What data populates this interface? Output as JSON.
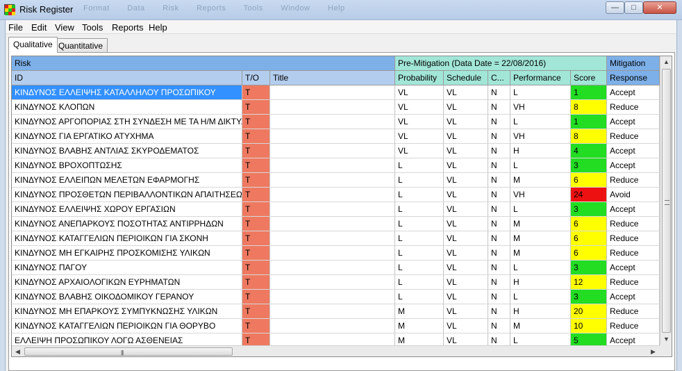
{
  "window": {
    "title": "Risk Register",
    "ghost_menu": [
      "Format",
      "Data",
      "Risk",
      "Reports",
      "Tools",
      "Window",
      "Help"
    ],
    "min_glyph": "—",
    "max_glyph": "□",
    "close_glyph": "✕"
  },
  "menubar": [
    "File",
    "Edit",
    "View",
    "Tools",
    "Reports",
    "Help"
  ],
  "tabs": [
    {
      "label": "Qualitative",
      "active": true
    },
    {
      "label": "Quantitative",
      "active": false
    }
  ],
  "grid": {
    "groups": {
      "risk": "Risk",
      "pre": "Pre-Mitigation (Data Date = 22/08/2016)",
      "mitigation": "Mitigation"
    },
    "columns": [
      "ID",
      "T/O",
      "Title",
      "Probability",
      "Schedule",
      "C...",
      "Performance",
      "Score",
      "Response"
    ],
    "rows": [
      {
        "id": "ΚΙΝΔΥΝΟΣ ΕΛΛΕΙΨΗΣ ΚΑΤΑΛΛΗΛΟΥ ΠΡΟΣΩΠΙΚΟΥ",
        "to": "T",
        "title": "",
        "prob": "VL",
        "sched": "VL",
        "cost": "N",
        "perf": "L",
        "score": "1",
        "level": "green",
        "response": "Accept",
        "selected": true
      },
      {
        "id": "ΚΙΝΔΥΝΟΣ ΚΛΟΠΩΝ",
        "to": "T",
        "title": "",
        "prob": "VL",
        "sched": "VL",
        "cost": "N",
        "perf": "VH",
        "score": "8",
        "level": "yellow",
        "response": "Reduce"
      },
      {
        "id": "ΚΙΝΔΥΝΟΣ ΑΡΓΟΠΟΡΙΑΣ ΣΤΗ ΣΥΝΔΕΣΗ ΜΕ ΤΑ Η/Μ ΔΙΚΤΥΑ",
        "to": "T",
        "title": "",
        "prob": "VL",
        "sched": "VL",
        "cost": "N",
        "perf": "L",
        "score": "1",
        "level": "green",
        "response": "Accept"
      },
      {
        "id": "ΚΙΝΔΥΝΟΣ ΓΙΑ ΕΡΓΑΤΙΚΟ ΑΤΥΧΗΜΑ",
        "to": "T",
        "title": "",
        "prob": "VL",
        "sched": "VL",
        "cost": "N",
        "perf": "VH",
        "score": "8",
        "level": "yellow",
        "response": "Reduce"
      },
      {
        "id": "ΚΙΝΔΥΝΟΣ ΒΛΑΒΗΣ ΑΝΤΛΙΑΣ ΣΚΥΡΟΔΕΜΑΤΟΣ",
        "to": "T",
        "title": "",
        "prob": "VL",
        "sched": "VL",
        "cost": "N",
        "perf": "H",
        "score": "4",
        "level": "green",
        "response": "Accept"
      },
      {
        "id": "ΚΙΝΔΥΝΟΣ ΒΡΟΧΟΠΤΩΣΗΣ",
        "to": "T",
        "title": "",
        "prob": "L",
        "sched": "VL",
        "cost": "N",
        "perf": "L",
        "score": "3",
        "level": "green",
        "response": "Accept"
      },
      {
        "id": "ΚΙΝΔΥΝΟΣ ΕΛΛΕΙΠΩΝ ΜΕΛΕΤΩΝ ΕΦΑΡΜΟΓΗΣ",
        "to": "T",
        "title": "",
        "prob": "L",
        "sched": "VL",
        "cost": "N",
        "perf": "M",
        "score": "6",
        "level": "yellow",
        "response": "Reduce"
      },
      {
        "id": "ΚΙΝΔΥΝΟΣ ΠΡΟΣΘΕΤΩΝ ΠΕΡΙΒΑΛΛΟΝΤΙΚΩΝ ΑΠΑΙΤΗΣΕΩΝ",
        "to": "T",
        "title": "",
        "prob": "L",
        "sched": "VL",
        "cost": "N",
        "perf": "VH",
        "score": "24",
        "level": "red",
        "response": "Avoid"
      },
      {
        "id": "ΚΙΝΔΥΝΟΣ ΕΛΛΕΙΨΗΣ ΧΩΡΟΥ ΕΡΓΑΣΙΩΝ",
        "to": "T",
        "title": "",
        "prob": "L",
        "sched": "VL",
        "cost": "N",
        "perf": "L",
        "score": "3",
        "level": "green",
        "response": "Accept"
      },
      {
        "id": "ΚΙΝΔΥΝΟΣ ΑΝΕΠΑΡΚΟΥΣ ΠΟΣΟΤΗΤΑΣ ΑΝΤΙΡΡΗΔΩΝ",
        "to": "T",
        "title": "",
        "prob": "L",
        "sched": "VL",
        "cost": "N",
        "perf": "M",
        "score": "6",
        "level": "yellow",
        "response": "Reduce"
      },
      {
        "id": "ΚΙΝΔΥΝΟΣ ΚΑΤΑΓΓΕΛΙΩΝ ΠΕΡΙΟΙΚΩΝ ΓΙΑ ΣΚΟΝΗ",
        "to": "T",
        "title": "",
        "prob": "L",
        "sched": "VL",
        "cost": "N",
        "perf": "M",
        "score": "6",
        "level": "yellow",
        "response": "Reduce"
      },
      {
        "id": "ΚΙΝΔΥΝΟΣ ΜΗ ΕΓΚΑΙΡΗΣ ΠΡΟΣΚΟΜΙΣΗΣ ΥΛΙΚΩΝ",
        "to": "T",
        "title": "",
        "prob": "L",
        "sched": "VL",
        "cost": "N",
        "perf": "M",
        "score": "6",
        "level": "yellow",
        "response": "Reduce"
      },
      {
        "id": "ΚΙΝΔΥΝΟΣ ΠΑΓΟΥ",
        "to": "T",
        "title": "",
        "prob": "L",
        "sched": "VL",
        "cost": "N",
        "perf": "L",
        "score": "3",
        "level": "green",
        "response": "Accept"
      },
      {
        "id": "ΚΙΝΔΥΝΟΣ ΑΡΧΑΙΟΛΟΓΙΚΩΝ ΕΥΡΗΜΑΤΩΝ",
        "to": "T",
        "title": "",
        "prob": "L",
        "sched": "VL",
        "cost": "N",
        "perf": "H",
        "score": "12",
        "level": "yellow",
        "response": "Reduce"
      },
      {
        "id": "ΚΙΝΔΥΝΟΣ ΒΛΑΒΗΣ ΟΙΚΟΔΟΜΙΚΟΥ ΓΕΡΑΝΟΥ",
        "to": "T",
        "title": "",
        "prob": "L",
        "sched": "VL",
        "cost": "N",
        "perf": "L",
        "score": "3",
        "level": "green",
        "response": "Accept"
      },
      {
        "id": "ΚΙΝΔΥΝΟΣ ΜΗ ΕΠΑΡΚΟΥΣ ΣΥΜΠΥΚΝΩΣΗΣ ΥΛΙΚΩΝ",
        "to": "T",
        "title": "",
        "prob": "M",
        "sched": "VL",
        "cost": "N",
        "perf": "H",
        "score": "20",
        "level": "yellow",
        "response": "Reduce"
      },
      {
        "id": "ΚΙΝΔΥΝΟΣ ΚΑΤΑΓΓΕΛΙΩΝ ΠΕΡΙΟΙΚΩΝ ΓΙΑ ΘΟΡΥΒΟ",
        "to": "T",
        "title": "",
        "prob": "M",
        "sched": "VL",
        "cost": "N",
        "perf": "M",
        "score": "10",
        "level": "yellow",
        "response": "Reduce"
      },
      {
        "id": "ΕΛΛΕΙΨΗ ΠΡΟΣΩΠΙΚΟΥ ΛΟΓΩ ΑΣΘΕΝΕΙΑΣ",
        "to": "T",
        "title": "",
        "prob": "M",
        "sched": "VL",
        "cost": "N",
        "perf": "L",
        "score": "5",
        "level": "green",
        "response": "Accept"
      }
    ]
  },
  "colors": {
    "green": "#22dd22",
    "yellow": "#ffff00",
    "red": "#ee1111",
    "to": "#ee7960",
    "selection": "#3390ff"
  },
  "scrollbar": {
    "up": "▲",
    "down": "▼",
    "left": "◀",
    "right": "▶",
    "h_grip": "|||",
    "v_grip": "≡"
  }
}
